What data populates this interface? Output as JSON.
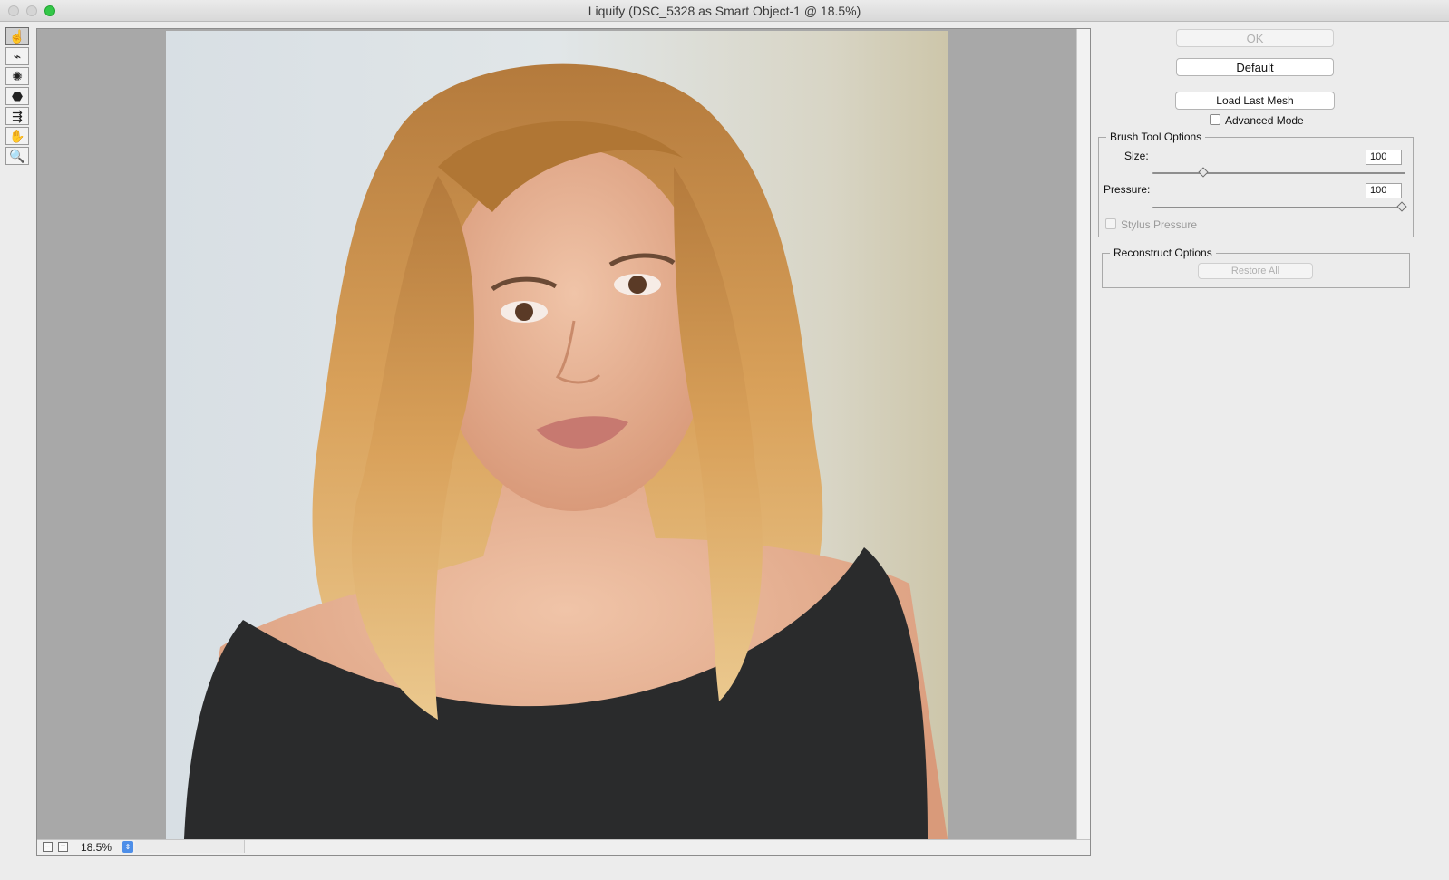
{
  "window": {
    "title": "Liquify (DSC_5328 as Smart Object-1 @ 18.5%)"
  },
  "tools": [
    {
      "name": "forward-warp-tool",
      "icon": "finger-warp-icon",
      "glyph": "☝"
    },
    {
      "name": "reconstruct-tool",
      "icon": "brush-reconstruct-icon",
      "glyph": "⌁"
    },
    {
      "name": "pucker-tool",
      "icon": "pucker-icon",
      "glyph": "✺"
    },
    {
      "name": "bloat-tool",
      "icon": "bloat-icon",
      "glyph": "⬣"
    },
    {
      "name": "push-left-tool",
      "icon": "push-left-icon",
      "glyph": "⇶"
    },
    {
      "name": "hand-tool",
      "icon": "hand-icon",
      "glyph": "✋"
    },
    {
      "name": "zoom-tool",
      "icon": "magnifier-icon",
      "glyph": "🔍"
    }
  ],
  "status": {
    "zoom": "18.5%",
    "zoom_out": "−",
    "zoom_in": "+"
  },
  "panel": {
    "ok": "OK",
    "default": "Default",
    "load_last_mesh": "Load Last Mesh",
    "advanced_mode": "Advanced Mode",
    "brush_tool_options": {
      "legend": "Brush Tool Options",
      "size_label": "Size:",
      "size_value": "100",
      "size_level": 0.2,
      "pressure_label": "Pressure:",
      "pressure_value": "100",
      "pressure_level": 1.0,
      "stylus_pressure": "Stylus Pressure"
    },
    "reconstruct_options": {
      "legend": "Reconstruct Options",
      "restore_all": "Restore All"
    }
  }
}
